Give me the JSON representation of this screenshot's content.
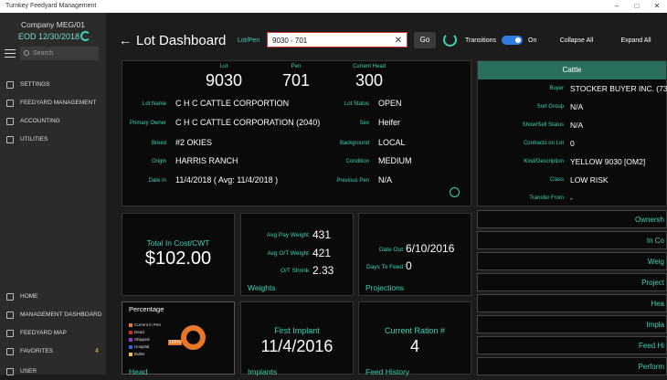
{
  "window": {
    "title": "Turnkey Feedyard Management"
  },
  "sidebar": {
    "company": "Company MEG/01",
    "eod": "EOD 12/30/2018",
    "search_placeholder": "Search",
    "top_items": [
      {
        "label": "SETTINGS",
        "icon": "gear-icon"
      },
      {
        "label": "FEEDYARD MANAGEMENT",
        "icon": "list-icon"
      },
      {
        "label": "ACCOUNTING",
        "icon": "calculator-icon"
      },
      {
        "label": "UTILITIES",
        "icon": "tools-icon"
      }
    ],
    "bottom_items": [
      {
        "label": "HOME",
        "icon": "home-icon"
      },
      {
        "label": "MANAGEMENT DASHBOARD",
        "icon": "dashboard-icon"
      },
      {
        "label": "FEEDYARD MAP",
        "icon": "map-icon"
      },
      {
        "label": "FAVORITES",
        "icon": "star-icon",
        "count": "4"
      },
      {
        "label": "USER",
        "icon": "user-icon"
      }
    ]
  },
  "header": {
    "title": "Lot Dashboard",
    "lotpen_label": "Lot/Pen",
    "lotpen_value": "9030 - 701",
    "go_label": "Go",
    "transitions_label": "Transitions",
    "toggle_state": "On",
    "collapse_all": "Collapse All",
    "expand_all": "Expand All"
  },
  "lot": {
    "lot_label": "Lot",
    "lot": "9030",
    "pen_label": "Pen",
    "pen": "701",
    "head_label": "Current Head",
    "head": "300",
    "fields_left": [
      {
        "label": "Lot Name",
        "value": "C H C CATTLE CORPORTION"
      },
      {
        "label": "Primary Owner",
        "value": "C H C CATTLE CORPORATION (2040)"
      },
      {
        "label": "Breed",
        "value": "#2 OKIES"
      },
      {
        "label": "Origin",
        "value": "HARRIS RANCH"
      },
      {
        "label": "Date In",
        "value": "11/4/2018  ( Avg: 11/4/2018 )"
      }
    ],
    "fields_right": [
      {
        "label": "Lot Status",
        "value": "OPEN"
      },
      {
        "label": "Sex",
        "value": "Heifer"
      },
      {
        "label": "Background",
        "value": "LOCAL"
      },
      {
        "label": "Condition",
        "value": "MEDIUM"
      },
      {
        "label": "Previous Pen",
        "value": "N/A"
      }
    ]
  },
  "cost": {
    "label": "Total In Cost/CWT",
    "value": "$102.00"
  },
  "weights": {
    "title": "Weights",
    "rows": [
      {
        "label": "Avg Pay Weight",
        "value": "431"
      },
      {
        "label": "Avg O/T Weight",
        "value": "421"
      },
      {
        "label": "O/T Shrink",
        "value": "2.33"
      }
    ]
  },
  "projections": {
    "title": "Projections",
    "date_out_label": "Date Out",
    "date_out": "6/10/2016",
    "days_label": "Days To Feed",
    "days": "0"
  },
  "percentage": {
    "title": "Percentage",
    "legend": [
      {
        "label": "Current in Pen",
        "color": "#e8762b"
      },
      {
        "label": "Dead",
        "color": "#d42a2a"
      },
      {
        "label": "Shipped",
        "color": "#8a3ccf"
      },
      {
        "label": "Hospital",
        "color": "#3a5ee0"
      },
      {
        "label": "Buller",
        "color": "#e8c33b"
      }
    ],
    "donut_label": "100%",
    "footer": "Head"
  },
  "implant": {
    "label": "First Implant",
    "value": "11/4/2016",
    "footer": "Implants"
  },
  "ration": {
    "label": "Current Ration #",
    "value": "4",
    "footer": "Feed History"
  },
  "cattle": {
    "title": "Cattle",
    "rows": [
      {
        "label": "Buyer",
        "value": "STOCKER BUYER INC. (73"
      },
      {
        "label": "Sort Group",
        "value": "N/A"
      },
      {
        "label": "Show/Sell Status",
        "value": "N/A"
      },
      {
        "label": "Contracts on Lot",
        "value": "0"
      },
      {
        "label": "Kind/Description",
        "value": "YELLOW 9030 [OM2]"
      },
      {
        "label": "Class",
        "value": "LOW RISK"
      },
      {
        "label": "Transfer From",
        "value": "-"
      }
    ]
  },
  "sections": [
    "Ownersh",
    "In Co",
    "Weig",
    "Project",
    "Hea",
    "Impla",
    "Feed Hi",
    "Perform"
  ]
}
